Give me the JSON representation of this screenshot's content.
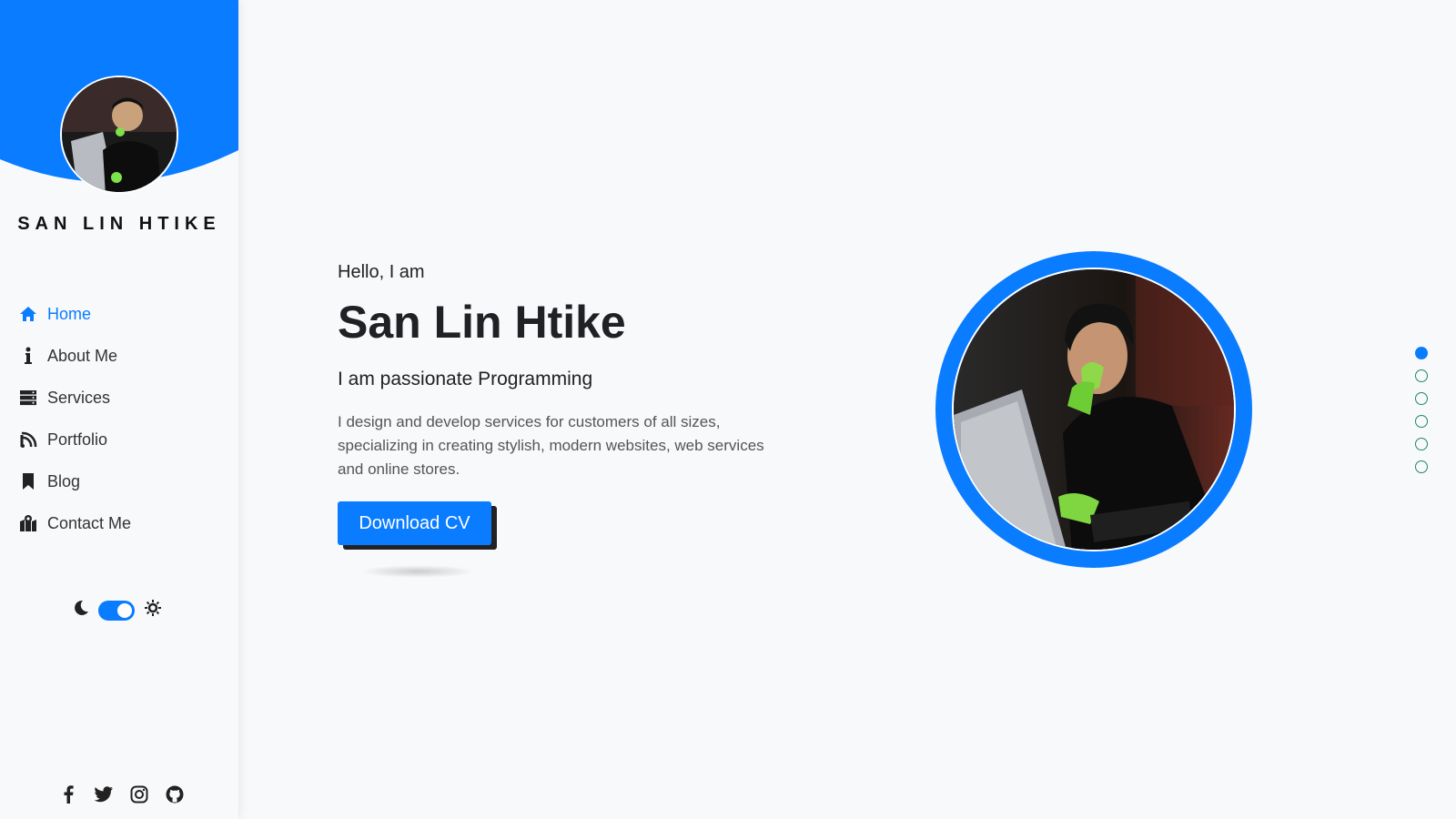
{
  "sidebar": {
    "brand_name": "SAN LIN HTIKE",
    "nav": [
      {
        "label": "Home",
        "icon": "home-icon",
        "active": true
      },
      {
        "label": "About Me",
        "icon": "info-icon",
        "active": false
      },
      {
        "label": "Services",
        "icon": "server-icon",
        "active": false
      },
      {
        "label": "Portfolio",
        "icon": "portfolio-icon",
        "active": false
      },
      {
        "label": "Blog",
        "icon": "bookmark-icon",
        "active": false
      },
      {
        "label": "Contact Me",
        "icon": "map-marker-icon",
        "active": false
      }
    ],
    "theme_toggle": {
      "state": "on",
      "left_icon": "moon-icon",
      "right_icon": "sun-icon"
    },
    "socials": [
      "facebook-icon",
      "twitter-icon",
      "instagram-icon",
      "github-icon"
    ]
  },
  "hero": {
    "greeting": "Hello, I am",
    "name": "San Lin Htike",
    "tagline": "I am passionate Programming",
    "description": "I design and develop services for customers of all sizes, specializing in creating stylish, modern websites, web services and online stores.",
    "cta_label": "Download CV"
  },
  "section_dots": {
    "count": 6,
    "active_index": 0
  },
  "colors": {
    "accent": "#0a7cff",
    "dot_border": "#1e8a5a",
    "text_dark": "#202124",
    "background": "#f8f9fb"
  }
}
